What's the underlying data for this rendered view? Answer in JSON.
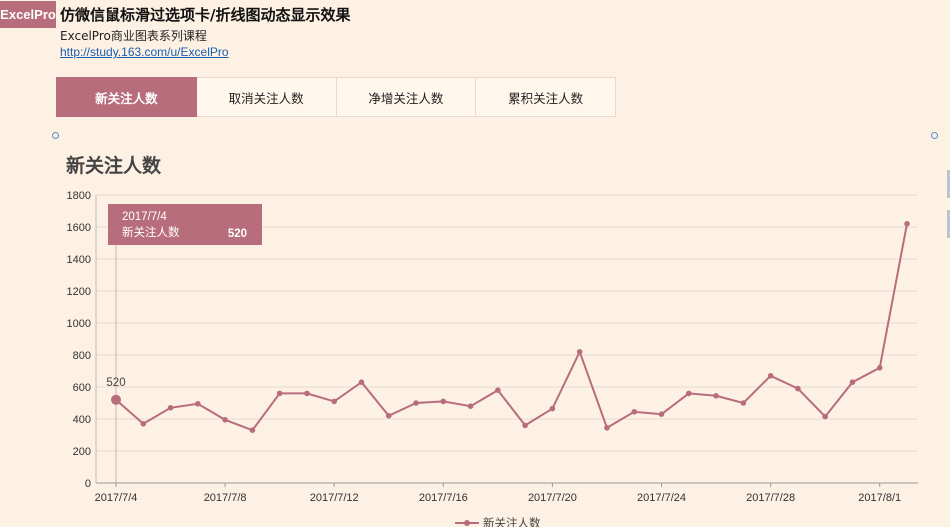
{
  "header": {
    "logo": "ExcelPro",
    "title": "仿微信鼠标滑过选项卡/折线图动态显示效果",
    "subtitle": "ExcelPro商业图表系列课程",
    "link": "http://study.163.com/u/ExcelPro"
  },
  "tabs": [
    {
      "label": "新关注人数",
      "active": true
    },
    {
      "label": "取消关注人数",
      "active": false
    },
    {
      "label": "净增关注人数",
      "active": false
    },
    {
      "label": "累积关注人数",
      "active": false
    }
  ],
  "colors": {
    "accent": "#b86d7c",
    "background": "#fdf1e3",
    "grid": "#e8dcd2",
    "axis_text": "#333333"
  },
  "chart_data": {
    "type": "line",
    "title": "新关注人数",
    "x": [
      "2017/7/4",
      "2017/7/5",
      "2017/7/6",
      "2017/7/7",
      "2017/7/8",
      "2017/7/9",
      "2017/7/10",
      "2017/7/11",
      "2017/7/12",
      "2017/7/13",
      "2017/7/14",
      "2017/7/15",
      "2017/7/16",
      "2017/7/17",
      "2017/7/18",
      "2017/7/19",
      "2017/7/20",
      "2017/7/21",
      "2017/7/22",
      "2017/7/23",
      "2017/7/24",
      "2017/7/25",
      "2017/7/26",
      "2017/7/27",
      "2017/7/28",
      "2017/7/29",
      "2017/7/30",
      "2017/7/31",
      "2017/8/1",
      "2017/8/2"
    ],
    "x_tick_labels": [
      "2017/7/4",
      "2017/7/8",
      "2017/7/12",
      "2017/7/16",
      "2017/7/20",
      "2017/7/24",
      "2017/7/28",
      "2017/8/1"
    ],
    "series": [
      {
        "name": "新关注人数",
        "values": [
          520,
          370,
          470,
          495,
          395,
          330,
          560,
          560,
          510,
          630,
          420,
          500,
          510,
          480,
          580,
          360,
          465,
          820,
          345,
          445,
          430,
          560,
          545,
          500,
          670,
          590,
          415,
          630,
          720,
          1620
        ]
      }
    ],
    "ylim": [
      0,
      1800
    ],
    "y_ticks": [
      0,
      200,
      400,
      600,
      800,
      1000,
      1200,
      1400,
      1600,
      1800
    ],
    "grid": true,
    "legend_position": "bottom",
    "highlight": {
      "label": "520",
      "tooltip_date": "2017/7/4",
      "tooltip_series": "新关注人数",
      "tooltip_value": "520"
    }
  }
}
